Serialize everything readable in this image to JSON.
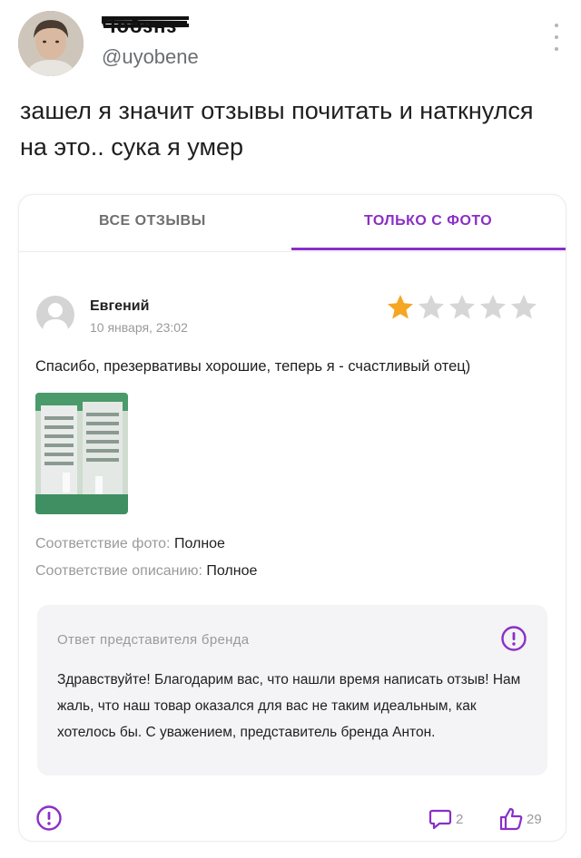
{
  "tweet": {
    "display_name": "Чобзнз",
    "handle": "@uyobene",
    "text": "зашел я значит отзывы почитать и наткнулся на это.. сука я умер"
  },
  "tabs": [
    {
      "label": "ВСЕ ОТЗЫВЫ",
      "active": false
    },
    {
      "label": "ТОЛЬКО С ФОТО",
      "active": true
    }
  ],
  "review": {
    "author": "Евгений",
    "date": "10 января, 23:02",
    "rating": 1,
    "max_rating": 5,
    "text": "Спасибо, презервативы хорошие, теперь я - счастливый отец)",
    "photo_match_label": "Соответствие фото:",
    "photo_match_value": "Полное",
    "desc_match_label": "Соответствие описанию:",
    "desc_match_value": "Полное"
  },
  "brand_reply": {
    "title": "Ответ представителя бренда",
    "text": "Здравствуйте! Благодарим вас, что нашли время написать отзыв! Нам жаль, что наш товар оказался для вас не таким идеальным, как хотелось бы. С уважением, представитель бренда Антон."
  },
  "footer": {
    "comments_count": "2",
    "likes_count": "29"
  },
  "colors": {
    "accent": "#8a2fc7",
    "star_filled": "#f5a623",
    "star_empty": "#d6d6d6"
  },
  "icons": {
    "more": "more-vertical-icon",
    "report": "alert-circle-icon",
    "comments": "comment-icon",
    "likes": "thumbs-up-icon"
  }
}
